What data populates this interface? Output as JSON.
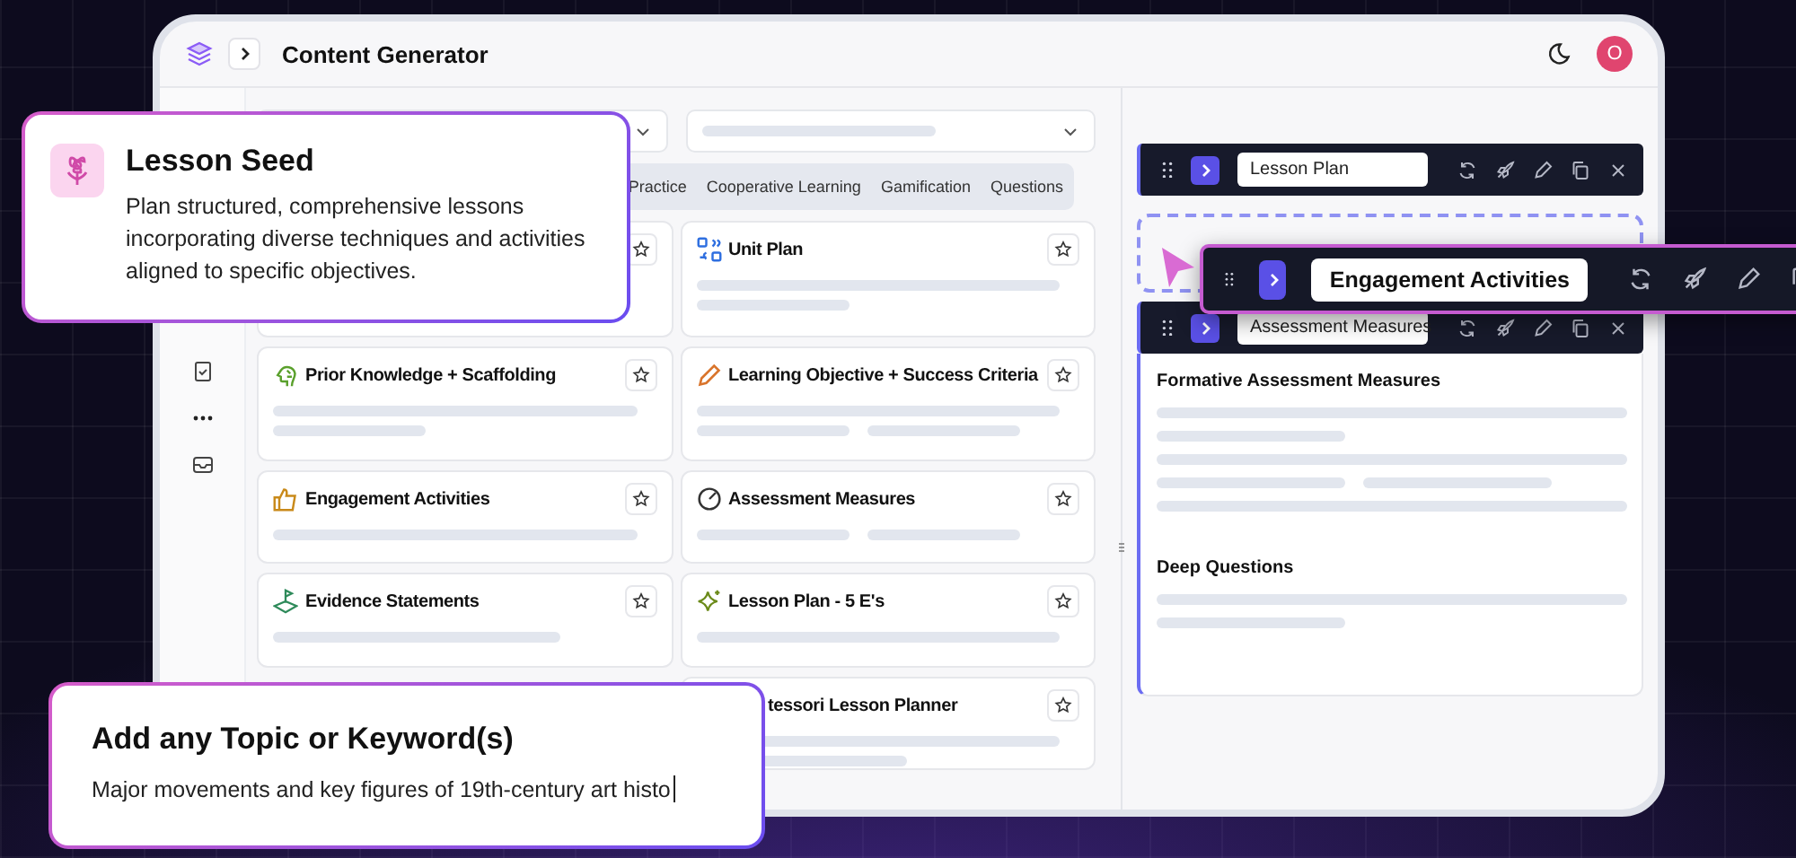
{
  "app": {
    "title": "Content Generator",
    "avatar": "O"
  },
  "tabs": [
    {
      "label": "Practice",
      "selected": false
    },
    {
      "label": "Cooperative Learning",
      "selected": false
    },
    {
      "label": "Gamification",
      "selected": false
    },
    {
      "label": "Questions",
      "selected": false
    }
  ],
  "tools": [
    {
      "starred": false
    },
    {
      "title": "Unit Plan",
      "starred": false
    },
    {
      "title": "Prior Knowledge + Scaffolding",
      "starred": false
    },
    {
      "title": "Learning Objective + Success Criteria",
      "starred": false
    },
    {
      "title": "Engagement Activities",
      "starred": false
    },
    {
      "title": "Assessment Measures",
      "starred": false
    },
    {
      "title": "Evidence Statements",
      "starred": false
    },
    {
      "title": "Lesson Plan - 5 E's",
      "starred": false
    },
    {
      "title": "tessori Lesson Planner",
      "starred": false
    }
  ],
  "blocks": [
    {
      "title": "Lesson Plan"
    },
    {
      "title": "Assessment Measures",
      "sections": [
        {
          "heading": "Formative Assessment Measures"
        },
        {
          "heading": "Deep Questions"
        }
      ]
    }
  ],
  "dragging": {
    "title": "Engagement Activities"
  },
  "lesson_seed": {
    "title": "Lesson Seed",
    "description": "Plan structured, comprehensive lessons incorporating diverse techniques and activities aligned to specific objectives."
  },
  "topic_input": {
    "title": "Add any Topic or Keyword(s)",
    "value": "Major movements and key figures of 19th-century art histo"
  }
}
